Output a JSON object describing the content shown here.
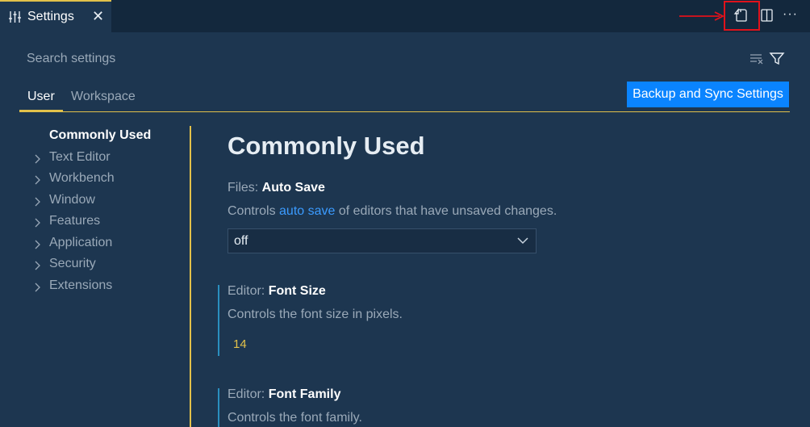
{
  "tab": {
    "label": "Settings",
    "close": "✕"
  },
  "toolbar": {
    "icons": [
      "open-settings-json-icon",
      "split-editor-icon",
      "more-actions-icon"
    ],
    "more": "···"
  },
  "search": {
    "placeholder": "Search settings"
  },
  "scopes": {
    "user": "User",
    "workspace": "Workspace"
  },
  "sync_button": "Backup and Sync Settings",
  "toc": {
    "active": "Commonly Used",
    "items": [
      "Text Editor",
      "Workbench",
      "Window",
      "Features",
      "Application",
      "Security",
      "Extensions"
    ]
  },
  "section_title": "Commonly Used",
  "settings": {
    "auto_save": {
      "category": "Files: ",
      "name": "Auto Save",
      "desc_before": "Controls ",
      "desc_link": "auto save",
      "desc_after": " of editors that have unsaved changes.",
      "value": "off"
    },
    "font_size": {
      "category": "Editor: ",
      "name": "Font Size",
      "desc": "Controls the font size in pixels.",
      "value": "14"
    },
    "font_family": {
      "category": "Editor: ",
      "name": "Font Family",
      "desc": "Controls the font family."
    }
  },
  "colors": {
    "background": "#1d3650",
    "accent": "#e2c14a",
    "button": "#0a84ff",
    "link": "#3b9bff",
    "annotation": "#e0121b"
  }
}
